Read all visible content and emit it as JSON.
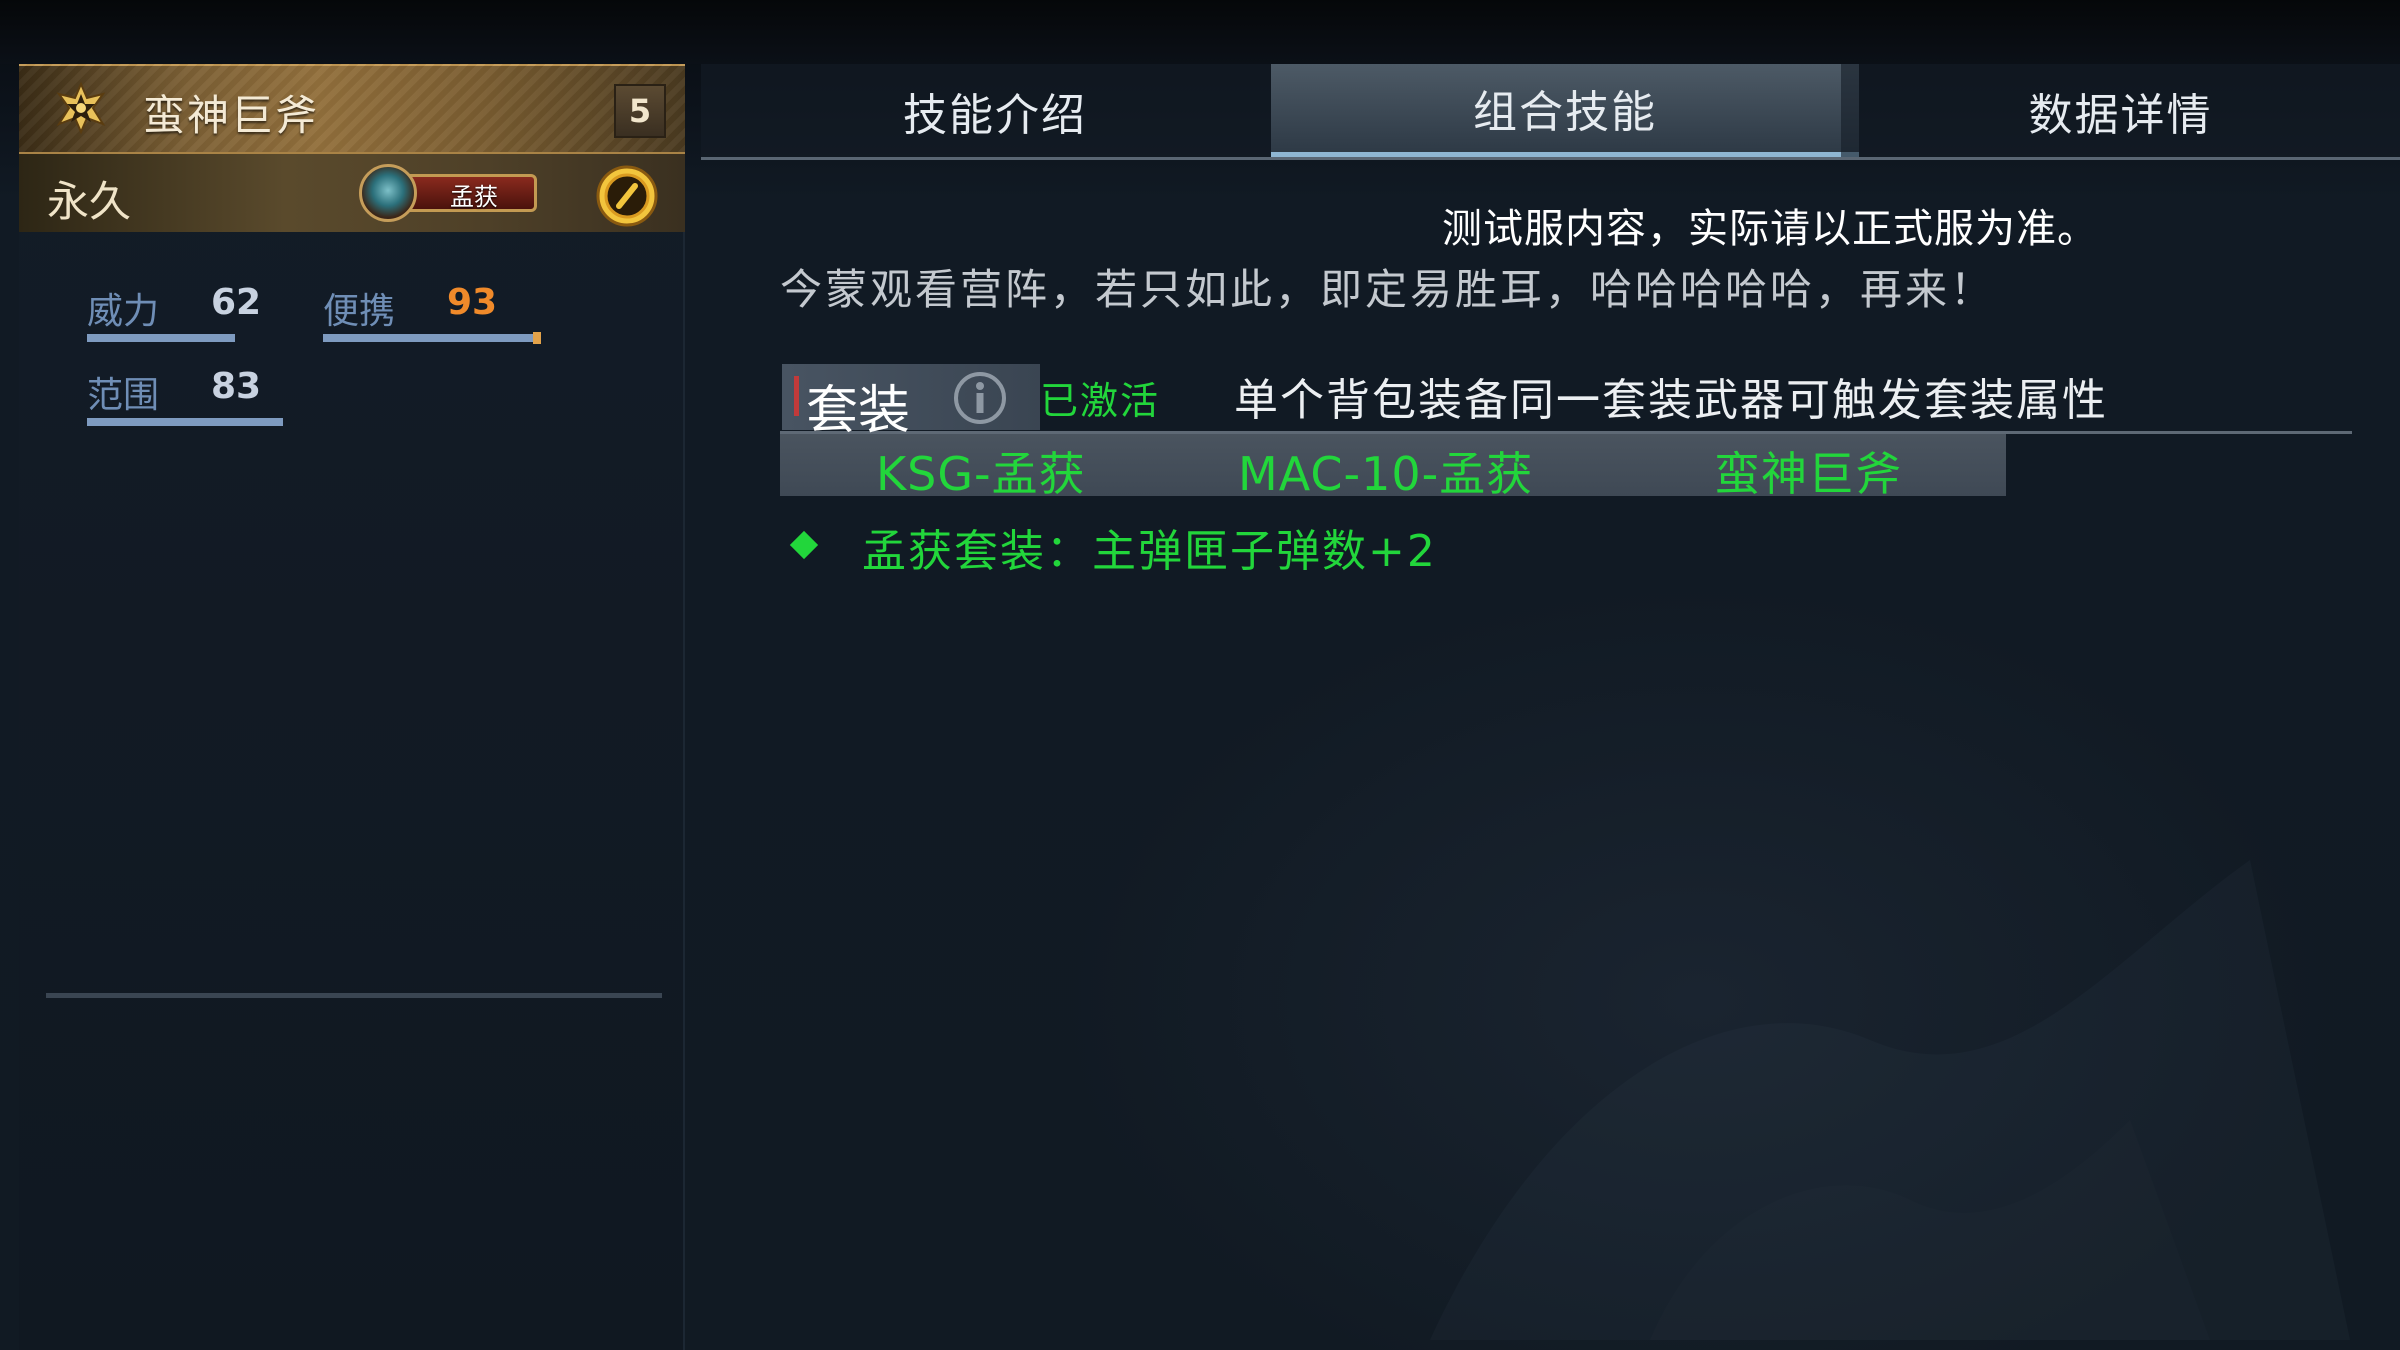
{
  "weapon": {
    "name": "蛮神巨斧",
    "level": "5",
    "duration": "永久",
    "suit_badge": "孟获",
    "stats": [
      {
        "label": "威力",
        "value": "62"
      },
      {
        "label": "便携",
        "value": "93"
      },
      {
        "label": "范围",
        "value": "83"
      }
    ]
  },
  "tabs": [
    {
      "label": "技能介绍",
      "active": false
    },
    {
      "label": "组合技能",
      "active": true
    },
    {
      "label": "数据详情",
      "active": false
    }
  ],
  "content": {
    "notice": "测试服内容，实际请以正式服为准。",
    "quote": "今蒙观看营阵，若只如此，即定易胜耳，哈哈哈哈哈，再来！",
    "set": {
      "tag": "套装",
      "status": "已激活",
      "description": "单个背包装备同一套装武器可触发套装属性",
      "items": [
        "KSG-孟获",
        "MAC-10-孟获",
        "蛮神巨斧"
      ],
      "bonus": "孟获套装：主弹匣子弹数+2"
    }
  },
  "colors": {
    "accent_green": "#22d63b",
    "tab_active": "#4d5a66",
    "stat_label": "#6f8eb6",
    "header_gold": "#93703c"
  },
  "icons": [
    "weapon-rank-icon",
    "coin-icon",
    "info-icon",
    "diamond-bullet-icon"
  ]
}
